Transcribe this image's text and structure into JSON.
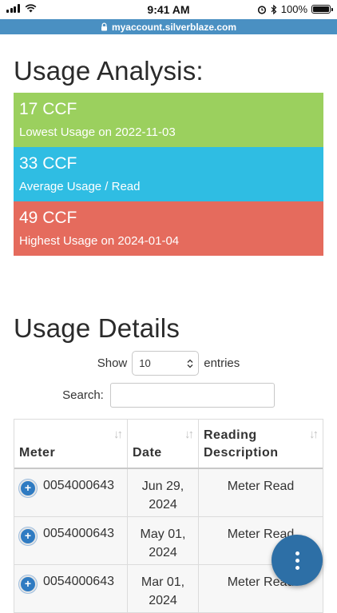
{
  "status_bar": {
    "time": "9:41 AM",
    "battery": "100%",
    "battery_level": 1.0
  },
  "browser": {
    "url": "myaccount.silverblaze.com"
  },
  "usage_analysis": {
    "title": "Usage Analysis:",
    "lowest": {
      "value": "17 CCF",
      "label": "Lowest Usage on 2022-11-03",
      "color": "#9bd05e"
    },
    "average": {
      "value": "33 CCF",
      "label": "Average Usage / Read",
      "color": "#2fbde3"
    },
    "highest": {
      "value": "49 CCF",
      "label": "Highest Usage on 2024-01-04",
      "color": "#e56b5d"
    }
  },
  "usage_details": {
    "title": "Usage Details",
    "show_label": "Show",
    "entries_label": "entries",
    "page_size": "10",
    "search_label": "Search:",
    "search_value": "",
    "columns": [
      "Meter",
      "Date",
      "Reading Description"
    ],
    "rows": [
      {
        "meter": "0054000643",
        "date": "Jun 29, 2024",
        "description": "Meter Read"
      },
      {
        "meter": "0054000643",
        "date": "May 01, 2024",
        "description": "Meter Read"
      },
      {
        "meter": "0054000643",
        "date": "Mar 01, 2024",
        "description": "Meter Read"
      }
    ]
  },
  "icons": {
    "sort": "sort-arrows-icon",
    "expand": "plus-circle-icon",
    "menu": "vertical-dots-icon",
    "lock": "lock-icon"
  }
}
